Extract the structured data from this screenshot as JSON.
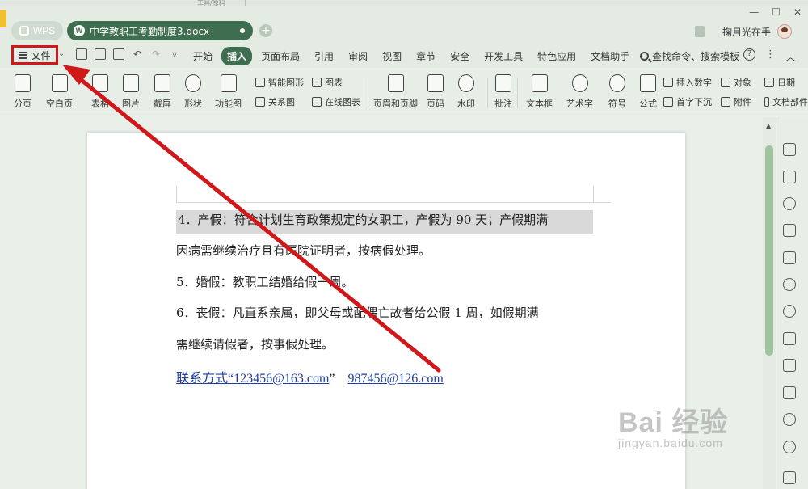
{
  "top_fragment": "工具/原料",
  "app_tab": {
    "label": "WPS"
  },
  "doc_tab": {
    "title": "中学教职工考勤制度3.docx"
  },
  "user": {
    "name": "掬月光在手"
  },
  "menu": {
    "file_label": "文件",
    "items": [
      "开始",
      "插入",
      "页面布局",
      "引用",
      "审阅",
      "视图",
      "章节",
      "安全",
      "开发工具",
      "特色应用",
      "文档助手"
    ],
    "active": "插入",
    "search_label": "查找命令、搜索模板"
  },
  "ribbon": {
    "big_items": [
      "分页",
      "空白页",
      "表格",
      "图片",
      "截屏",
      "形状",
      "功能图",
      "页眉和页脚",
      "页码",
      "水印",
      "批注",
      "文本框",
      "艺术字",
      "符号",
      "公式",
      "日期",
      "文档部件"
    ],
    "small_items": [
      "智能图形",
      "图表",
      "关系图",
      "在线图表",
      "插入数字",
      "对象",
      "首字下沉",
      "附件"
    ]
  },
  "document": {
    "p1": "4．产假：符合计划生育政策规定的女职工，产假为 90 天；产假期满",
    "p2": "因病需继续治疗且有医院证明者，按病假处理。",
    "p3": "5．婚假：教职工结婚给假一周。",
    "p4": "6．丧假：凡直系亲属，即父母或配偶亡故者给公假 1 周，如假期满",
    "p5": "需继续请假者，按事假处理。",
    "contact_prefix": "联系方式“123456@163.com",
    "contact_quote": "”",
    "contact_email2": "987456@126.com"
  },
  "watermark": {
    "brand": "Bai  经验",
    "url": "jingyan.baidu.com"
  },
  "colors": {
    "accent": "#3f6d4f",
    "highlight_box": "#d0181a",
    "arrow": "#d0181a",
    "link": "#1f3fa0"
  }
}
